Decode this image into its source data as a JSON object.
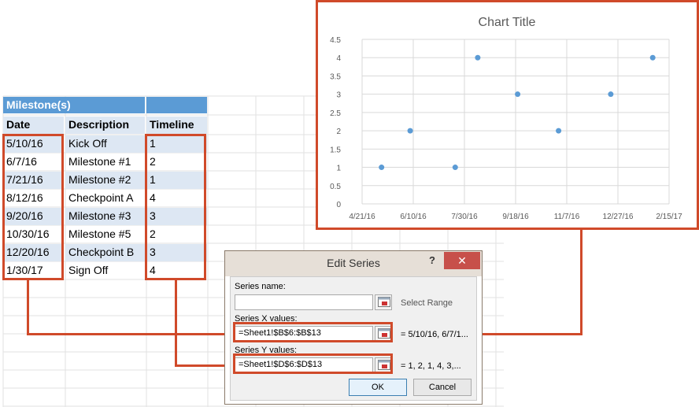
{
  "table": {
    "title": "Milestone(s)",
    "headers": [
      "Date",
      "Description",
      "Timeline"
    ],
    "rows": [
      {
        "date": "5/10/16",
        "description": "Kick Off",
        "timeline": "1"
      },
      {
        "date": "6/7/16",
        "description": "Milestone #1",
        "timeline": "2"
      },
      {
        "date": "7/21/16",
        "description": "Milestone #2",
        "timeline": "1"
      },
      {
        "date": "8/12/16",
        "description": "Checkpoint A",
        "timeline": "4"
      },
      {
        "date": "9/20/16",
        "description": "Milestone #3",
        "timeline": "3"
      },
      {
        "date": "10/30/16",
        "description": "Milestone #5",
        "timeline": "2"
      },
      {
        "date": "12/20/16",
        "description": "Checkpoint B",
        "timeline": "3"
      },
      {
        "date": "1/30/17",
        "description": "Sign Off",
        "timeline": "4"
      }
    ]
  },
  "chart_data": {
    "type": "scatter",
    "title": "Chart Title",
    "x": [
      "2016-05-10",
      "2016-06-07",
      "2016-07-21",
      "2016-08-12",
      "2016-09-20",
      "2016-10-30",
      "2016-12-20",
      "2017-01-30"
    ],
    "y": [
      1,
      2,
      1,
      4,
      3,
      2,
      3,
      4
    ],
    "xlim": [
      "2016-04-21",
      "2017-02-15"
    ],
    "x_tick_labels": [
      "4/21/16",
      "6/10/16",
      "7/30/16",
      "9/18/16",
      "11/7/16",
      "12/27/16",
      "2/15/17"
    ],
    "x_ticks": [
      "2016-04-21",
      "2016-06-10",
      "2016-07-30",
      "2016-09-18",
      "2016-11-07",
      "2016-12-27",
      "2017-02-15"
    ],
    "ylim": [
      0,
      4.5
    ],
    "y_tick_labels": [
      "0",
      "0.5",
      "1",
      "1.5",
      "2",
      "2.5",
      "3",
      "3.5",
      "4",
      "4.5"
    ],
    "y_ticks": [
      0,
      0.5,
      1,
      1.5,
      2,
      2.5,
      3,
      3.5,
      4,
      4.5
    ],
    "grid": true,
    "colors": {
      "marker": "#5b9bd5",
      "grid": "#d9d9d9",
      "title": "#595959",
      "tick": "#595959"
    }
  },
  "dialog": {
    "title": "Edit Series",
    "help": "?",
    "close": "✕",
    "series_name_label": "Series name:",
    "series_name_value": "",
    "select_range": "Select Range",
    "x_values_label_pre": "Series ",
    "x_values_label_ul": "X",
    "x_values_label_post": " values:",
    "x_values_value": "=Sheet1!$B$6:$B$13",
    "x_values_preview": "= 5/10/16, 6/7/1...",
    "y_values_label_pre": "Series ",
    "y_values_label_ul": "Y",
    "y_values_label_post": " values:",
    "y_values_value": "=Sheet1!$D$6:$D$13",
    "y_values_preview": "= 1, 2, 1, 4, 3,...",
    "ok": "OK",
    "cancel": "Cancel"
  },
  "colors": {
    "highlight": "#d04a2a",
    "header_blue": "#5b9bd5",
    "band": "#dde7f3"
  }
}
